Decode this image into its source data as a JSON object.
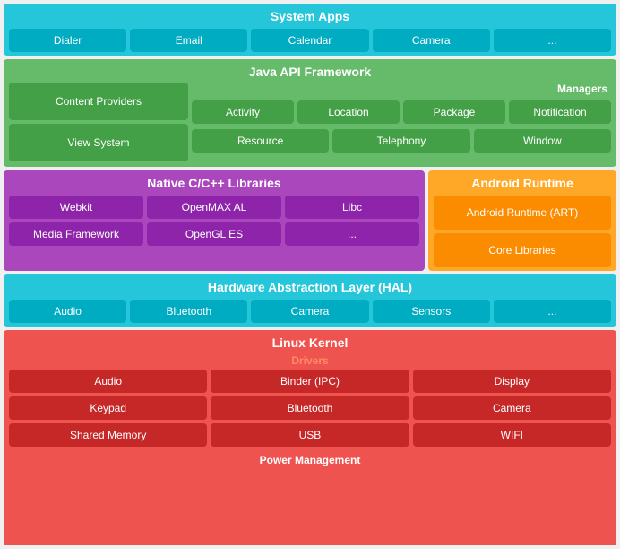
{
  "layers": {
    "system_apps": {
      "title": "System Apps",
      "color": "#26C6DA",
      "cell_color": "#00ACC1",
      "items": [
        "Dialer",
        "Email",
        "Calendar",
        "Camera",
        "..."
      ]
    },
    "java_api": {
      "title": "Java API Framework",
      "color": "#66BB6A",
      "cell_color": "#43A047",
      "left": {
        "items": [
          "Content Providers",
          "View System"
        ]
      },
      "right": {
        "managers_label": "Managers",
        "row1": [
          "Activity",
          "Location",
          "Package",
          "Notification"
        ],
        "row2": [
          "Resource",
          "Telephony",
          "Window"
        ]
      }
    },
    "native": {
      "title": "Native C/C++ Libraries",
      "color": "#AB47BC",
      "cell_color": "#8E24AA",
      "row1": [
        "Webkit",
        "OpenMAX AL",
        "Libc"
      ],
      "row2": [
        "Media Framework",
        "OpenGL ES",
        "..."
      ]
    },
    "android_runtime": {
      "title": "Android Runtime",
      "color": "#FFA726",
      "cell_color": "#FB8C00",
      "items": [
        "Android Runtime (ART)",
        "Core Libraries"
      ]
    },
    "hal": {
      "title": "Hardware Abstraction Layer (HAL)",
      "color": "#26C6DA",
      "cell_color": "#00ACC1",
      "items": [
        "Audio",
        "Bluetooth",
        "Camera",
        "Sensors",
        "..."
      ]
    },
    "kernel": {
      "title": "Linux Kernel",
      "color": "#EF5350",
      "cell_color": "#C62828",
      "drivers_label": "Drivers",
      "row1": [
        "Audio",
        "Binder (IPC)",
        "Display"
      ],
      "row2": [
        "Keypad",
        "Bluetooth",
        "Camera"
      ],
      "row3": [
        "Shared Memory",
        "USB",
        "WIFI"
      ],
      "power_management": "Power Management"
    }
  }
}
